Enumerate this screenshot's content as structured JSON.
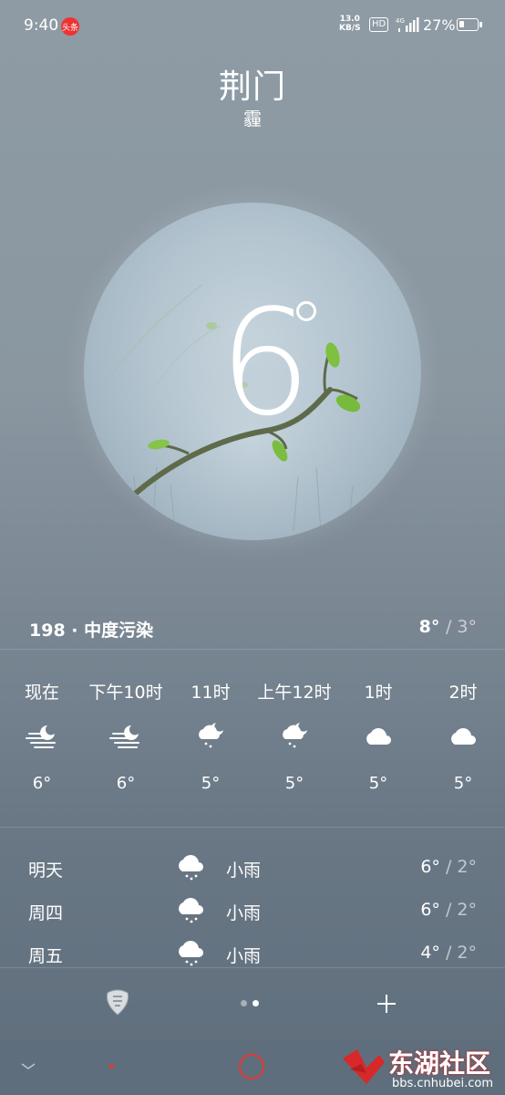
{
  "status_bar": {
    "time": "9:40",
    "news_badge": "头条",
    "net_speed_value": "13.0",
    "net_speed_unit": "KB/S",
    "hd": "HD",
    "network": "4G",
    "battery_percent": "27%",
    "battery_level": 0.27
  },
  "location": {
    "city": "荆门",
    "condition": "霾"
  },
  "current": {
    "temp": "6",
    "aqi_text": "198 · 中度污染",
    "high": "8°",
    "low": "/ 3°"
  },
  "hourly": [
    {
      "label": "现在",
      "icon": "haze-night-icon",
      "temp": "6°"
    },
    {
      "label": "下午10时",
      "icon": "haze-night-icon",
      "temp": "6°"
    },
    {
      "label": "11时",
      "icon": "night-shower-icon",
      "temp": "5°"
    },
    {
      "label": "上午12时",
      "icon": "night-shower-icon",
      "temp": "5°"
    },
    {
      "label": "1时",
      "icon": "cloud-icon",
      "temp": "5°"
    },
    {
      "label": "2时",
      "icon": "cloud-icon",
      "temp": "5°"
    }
  ],
  "daily": [
    {
      "day": "明天",
      "icon": "light-rain-icon",
      "desc": "小雨",
      "high": "6°",
      "low": "/ 2°"
    },
    {
      "day": "周四",
      "icon": "light-rain-icon",
      "desc": "小雨",
      "high": "6°",
      "low": "/ 2°"
    },
    {
      "day": "周五",
      "icon": "light-rain-icon",
      "desc": "小雨",
      "high": "4°",
      "low": "/ 2°"
    }
  ],
  "bottom": {
    "page_count": 2,
    "active_page": 2
  },
  "watermark": {
    "brand": "东湖社区",
    "url": "bbs.cnhubei.com"
  },
  "colors": {
    "nav_home": "#e53935",
    "watermark_red": "#d8282a"
  }
}
